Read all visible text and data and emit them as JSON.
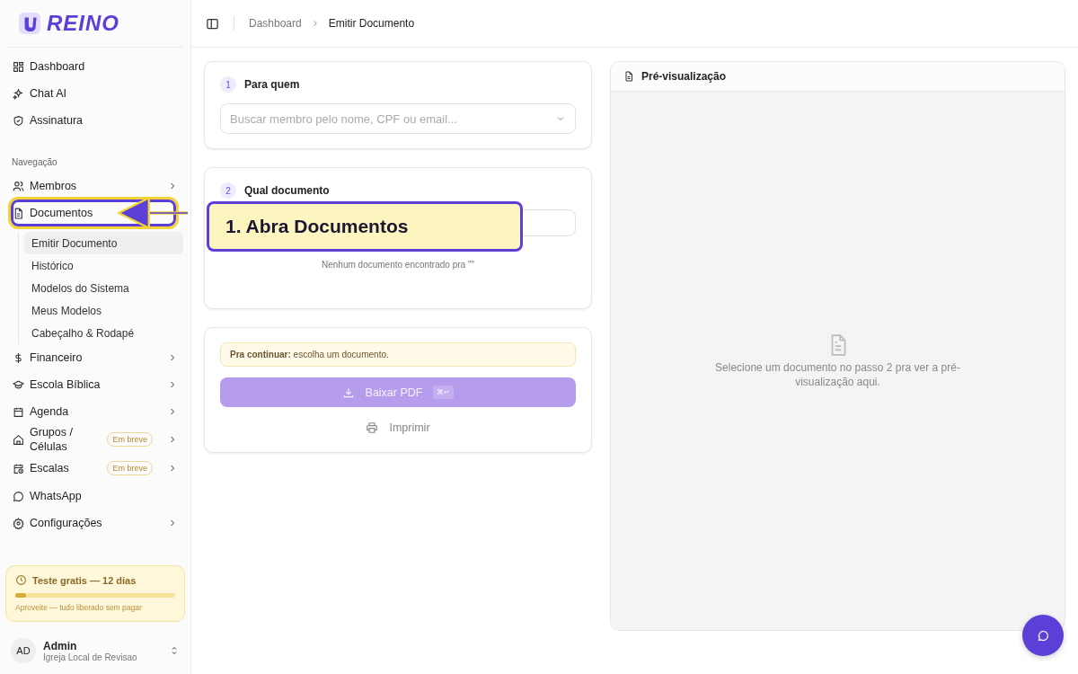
{
  "brand": {
    "name": "REINO"
  },
  "sidebar": {
    "top_items": [
      {
        "label": "Dashboard"
      },
      {
        "label": "Chat AI"
      },
      {
        "label": "Assinatura"
      }
    ],
    "section_title": "Navegação",
    "nav_items": [
      {
        "label": "Membros",
        "expanded": false
      },
      {
        "label": "Documentos",
        "expanded": true,
        "children": [
          {
            "label": "Emitir Documento",
            "selected": true
          },
          {
            "label": "Histórico",
            "selected": false
          },
          {
            "label": "Modelos do Sistema",
            "selected": false
          },
          {
            "label": "Meus Modelos",
            "selected": false
          },
          {
            "label": "Cabeçalho & Rodapé",
            "selected": false
          }
        ]
      },
      {
        "label": "Financeiro",
        "expanded": false
      },
      {
        "label": "Escola Bíblica",
        "expanded": false
      },
      {
        "label": "Agenda",
        "expanded": false
      },
      {
        "label": "Grupos / Células",
        "expanded": false,
        "badge": "Em breve"
      },
      {
        "label": "Escalas",
        "expanded": false,
        "badge": "Em breve"
      },
      {
        "label": "WhatsApp"
      },
      {
        "label": "Configurações",
        "expanded": false
      }
    ],
    "trial": {
      "title": "Teste gratis — 12 dias",
      "level": 0.07,
      "note": "Aproveite — tudo liberado sem pagar"
    },
    "user": {
      "initials": "AD",
      "name": "Admin",
      "org": "Igreja Local de Revisao"
    }
  },
  "breadcrumb": [
    {
      "label": "Dashboard",
      "current": false
    },
    {
      "label": "Emitir Documento",
      "current": true
    }
  ],
  "steps": [
    {
      "number": "1",
      "title": "Para quem",
      "kind": "select",
      "placeholder": "Buscar membro pelo nome, CPF ou email..."
    },
    {
      "number": "2",
      "title": "Qual documento",
      "kind": "list",
      "empty_message": "Nenhum documento encontrado pra \"\""
    }
  ],
  "actions": {
    "notice": "**Pra continuar:** escolha um documento.",
    "download": {
      "label": "Baixar PDF",
      "shortcut": "⌘↵",
      "disabled": true
    },
    "print": {
      "label": "Imprimir",
      "disabled": true
    }
  },
  "preview": {
    "title": "Pré-visualização",
    "empty_message": "Selecione um documento no passo 2 pra ver a pré-visualização aqui."
  },
  "tutorial": {
    "callout": "1. Abra Documentos"
  }
}
